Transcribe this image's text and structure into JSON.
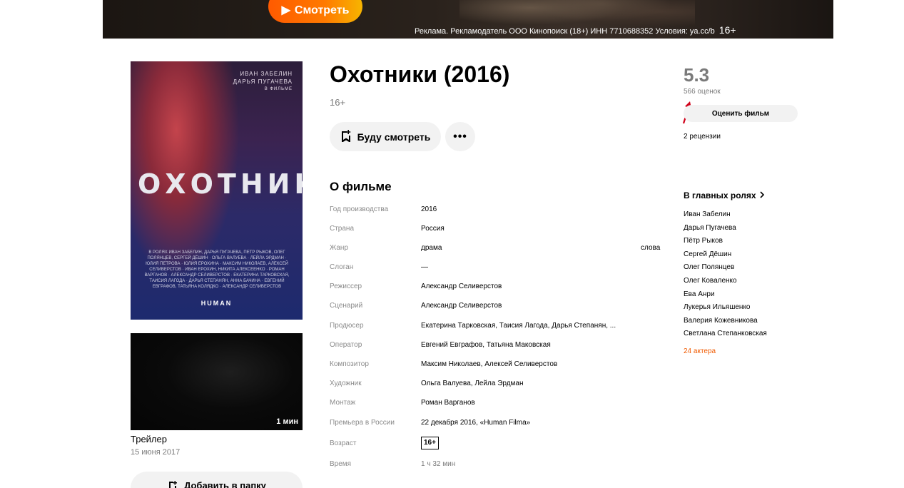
{
  "banner": {
    "watch_label": "Смотреть",
    "ad_text": "Реклама. Рекламодатель ООО Кинопоиск (18+) ИНН 7710688352 Условия: ya.cc/b",
    "ad_age": "16+"
  },
  "poster": {
    "actor1": "ИВАН ЗАБЕЛИН",
    "actor2": "ДАРЬЯ ПУГАЧЕВА",
    "subtitle": "В ФИЛЬМЕ",
    "title": "ОХОТНИКИ",
    "credits": "В РОЛЯХ ИВАН ЗАБЕЛИН, ДАРЬЯ ПУГАЧЕВА, ПЕТР РЫКОВ, ОЛЕГ ПОЛЯНЦЕВ, СЕРГЕЙ ДЁШИН · ОЛЬГА ВАЛУЕВА · ЛЕЙЛА ЭРДМАН · ЮЛИЯ ПЕТРОВА · ЮЛИЯ ЕРОХИНА · МАКСИМ НИКОЛАЕВ, АЛЕКСЕЙ СЕЛИВЕРСТОВ · ИВАН ЕРОХИН, НИКИТА АЛЕКСЕЕНКО · РОМАН ВАРГАНОВ · АЛЕКСАНДР СЕЛИВЕРСТОВ · ЕКАТЕРИНА ТАРКОВСКАЯ, ТАИСИЯ ЛАГОДА · ДАРЬЯ СТЕПАНЯН, АННА БАЧИНА · ЕВГЕНИЙ ЕВГРАФОВ, ТАТЬЯНА КОЛЯДКО · АЛЕКСАНДР СЕЛИВЕРСТОВ",
    "logo": "HUMAN"
  },
  "trailer": {
    "duration": "1 мин",
    "title": "Трейлер",
    "date": "15 июня 2017"
  },
  "folder_button": "Добавить в папку",
  "film": {
    "title": "Охотники (2016)",
    "age": "16+",
    "watch_later_label": "Буду смотреть",
    "more_label": "•••"
  },
  "about": {
    "title": "О фильме",
    "rows": [
      {
        "label": "Год производства",
        "value": "2016"
      },
      {
        "label": "Страна",
        "value": "Россия"
      },
      {
        "label": "Жанр",
        "value": "драма",
        "extra": "слова"
      },
      {
        "label": "Слоган",
        "value": "—"
      },
      {
        "label": "Режиссер",
        "value": "Александр Селиверстов"
      },
      {
        "label": "Сценарий",
        "value": "Александр Селиверстов"
      },
      {
        "label": "Продюсер",
        "value": "Екатерина Тарковская, Таисия Лагода, Дарья Степанян, ..."
      },
      {
        "label": "Оператор",
        "value": "Евгений Евграфов, Татьяна Маковская"
      },
      {
        "label": "Композитор",
        "value": "Максим Николаев, Алексей Селиверстов"
      },
      {
        "label": "Художник",
        "value": "Ольга Валуева, Лейла Эрдман"
      },
      {
        "label": "Монтаж",
        "value": "Роман Варганов"
      },
      {
        "label": "Премьера в России",
        "value": "22 декабря 2016, «Human Filma»"
      },
      {
        "label": "Возраст",
        "value": "16+"
      },
      {
        "label": "Время",
        "value": "1 ч 32 мин"
      }
    ]
  },
  "rating": {
    "score": "5.3",
    "votes": "566 оценок",
    "rate_label": "Оценить фильм",
    "reviews": "2 рецензии",
    "accent_color": "#d0021b"
  },
  "cast": {
    "title": "В главных ролях",
    "actors": [
      "Иван Забелин",
      "Дарья Пугачева",
      "Пётр Рыков",
      "Сергей Дёшин",
      "Олег Полянцев",
      "Олег Коваленко",
      "Ева Анри",
      "Лукерья Ильяшенко",
      "Валерия Кожевникова",
      "Светлана Степанковская"
    ],
    "more": "24 актера"
  }
}
